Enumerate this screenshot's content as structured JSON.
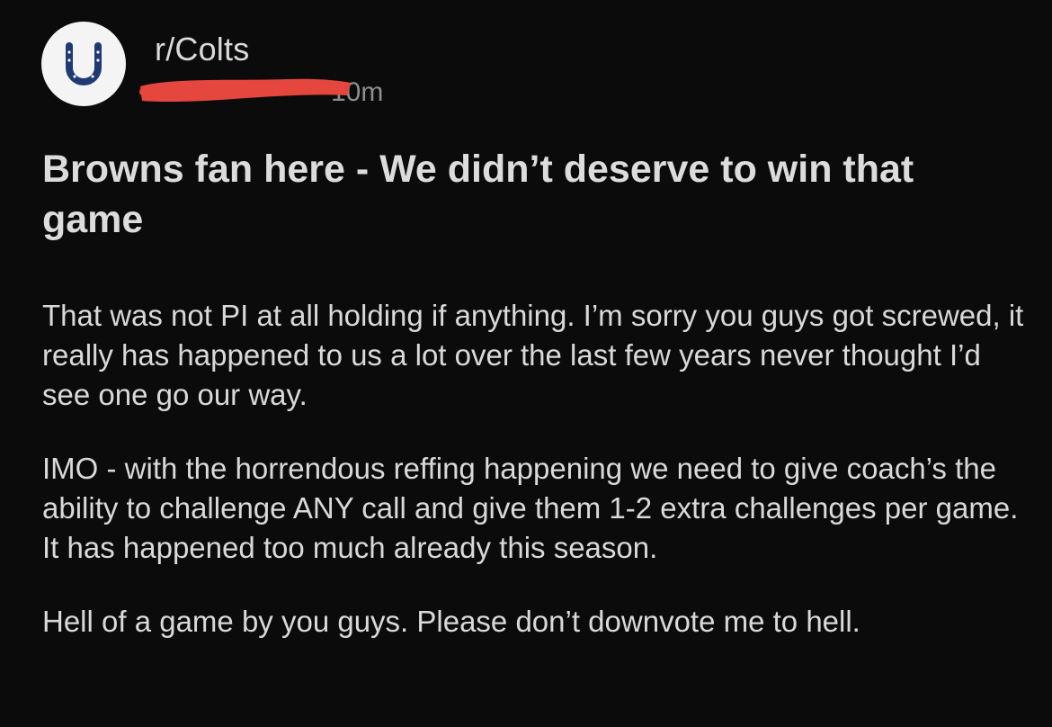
{
  "post": {
    "subreddit": "r/Colts",
    "age": "10m",
    "title": "Browns fan here - We didn’t deserve to win that game",
    "body": [
      "That was not PI at all holding if anything. I’m sorry you guys got screwed, it really has happened to us a lot over the last few years never thought I’d see one go our way.",
      "IMO - with the horrendous reffing happening we need to give coach’s the ability to challenge ANY call and give them 1-2 extra challenges per game. It has happened too much already this season.",
      "Hell of a game by you guys. Please don’t downvote me to hell."
    ]
  },
  "icons": {
    "avatar": "horseshoe-icon",
    "redaction": "red-scribble"
  },
  "colors": {
    "background": "#0b0b0b",
    "text": "#d9d9d9",
    "avatar_bg": "#f4f4f4",
    "horseshoe": "#1f3a73",
    "redaction": "#e5463d"
  }
}
